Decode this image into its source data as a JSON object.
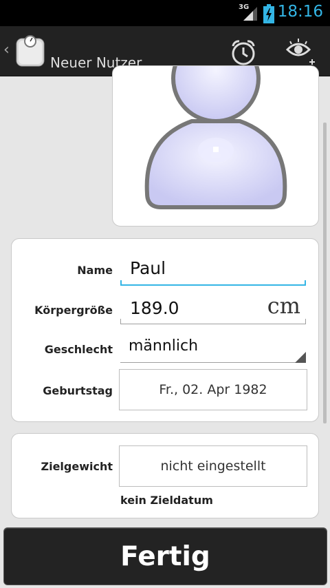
{
  "status_bar": {
    "network": "3G",
    "time": "18:16"
  },
  "action_bar": {
    "title": "Neuer Nutzer"
  },
  "form": {
    "name_label": "Name",
    "name_value": "Paul",
    "height_label": "Körpergröße",
    "height_value": "189.0",
    "height_unit": "cm",
    "gender_label": "Geschlecht",
    "gender_value": "männlich",
    "birthday_label": "Geburtstag",
    "birthday_value": "Fr., 02. Apr 1982"
  },
  "goal": {
    "target_weight_label": "Zielgewicht",
    "target_weight_value": "nicht eingestellt",
    "target_date_text": "kein Zieldatum"
  },
  "footer": {
    "done_label": "Fertig"
  },
  "colors": {
    "accent": "#33b5e5",
    "background": "#e6e6e6",
    "action_bar": "#222222",
    "button": "#232323"
  }
}
